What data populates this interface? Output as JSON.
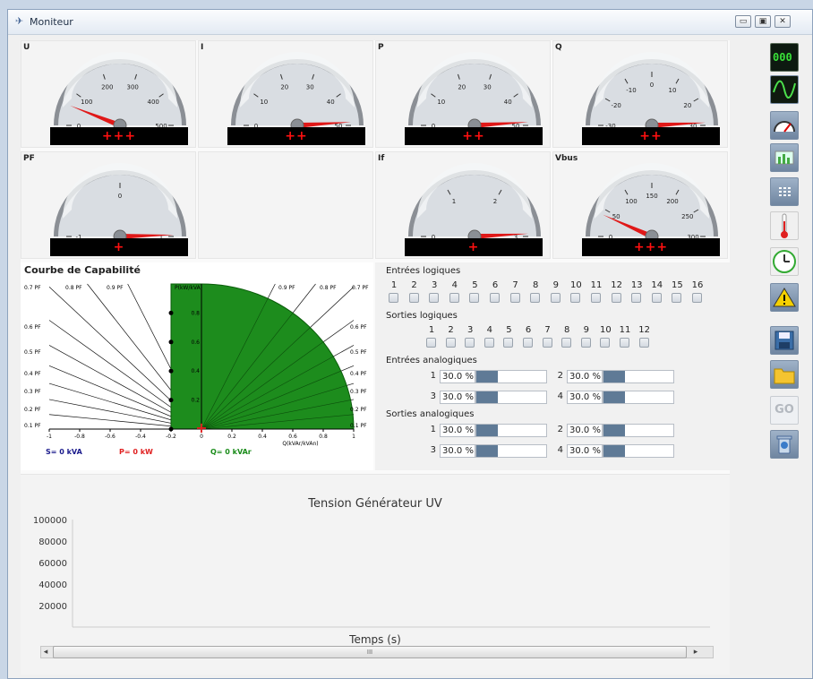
{
  "window": {
    "title": "Moniteur",
    "minimize": "▭",
    "maximize": "▣",
    "close": "✕"
  },
  "gauges": [
    {
      "id": "U",
      "label": "U",
      "ticks": [
        "0",
        "100",
        "200",
        "300",
        "400",
        "500"
      ],
      "indicator": "+++",
      "value": 60,
      "min": 0,
      "max": 500
    },
    {
      "id": "I",
      "label": "I",
      "ticks": [
        "0",
        "10",
        "20",
        "30",
        "40",
        "50"
      ],
      "indicator": "++",
      "value": 49,
      "min": 0,
      "max": 50
    },
    {
      "id": "P",
      "label": "P",
      "ticks": [
        "0",
        "10",
        "20",
        "30",
        "40",
        "50"
      ],
      "indicator": "++",
      "value": 49,
      "min": 0,
      "max": 50
    },
    {
      "id": "Q",
      "label": "Q",
      "ticks": [
        "-30",
        "-20",
        "-10",
        "0",
        "10",
        "20",
        "30"
      ],
      "indicator": "++",
      "value": 29,
      "min": -30,
      "max": 30
    },
    {
      "id": "PF",
      "label": "PF",
      "ticks": [
        "-1",
        "0",
        "1"
      ],
      "indicator": "+",
      "value": 0.98,
      "min": -1,
      "max": 1
    },
    {
      "id": "If",
      "label": "If",
      "ticks": [
        "0",
        "1",
        "2",
        "3"
      ],
      "indicator": "+",
      "value": 2.95,
      "min": 0,
      "max": 3
    },
    {
      "id": "Vbus",
      "label": "Vbus",
      "ticks": [
        "0",
        "50",
        "100",
        "150",
        "200",
        "250",
        "300"
      ],
      "indicator": "+++",
      "value": 40,
      "min": 0,
      "max": 300
    }
  ],
  "capability": {
    "title": "Courbe de Capabilité",
    "pf_left": [
      "0.7 PF",
      "0.8 PF",
      "0.9 PF",
      "0.6 PF",
      "0.5 PF",
      "0.4 PF",
      "0.3 PF",
      "0.2 PF",
      "0.1 PF"
    ],
    "pf_right": [
      "0.9 PF",
      "0.8 PF",
      "0.7 PF",
      "0.6 PF",
      "0.5 PF",
      "0.4 PF",
      "0.3 PF",
      "0.2 PF",
      "0.1 PF"
    ],
    "xticks": [
      "-1",
      "-0.8",
      "-0.6",
      "-0.4",
      "-0.2",
      "0",
      "0.2",
      "0.4",
      "0.6",
      "0.8",
      "1"
    ],
    "yticks": [
      "0.2",
      "0.4",
      "0.6",
      "0.8"
    ],
    "yaxis": "P(kW/kVA)",
    "xaxis": "Q(kVAr/kVAn)",
    "s_label": "S= 0 kVA",
    "p_label": "P= 0 kW",
    "q_label": "Q= 0 kVAr",
    "colors": {
      "fill": "#1d8c1d",
      "s": "#1a1a8c",
      "p": "#e02020",
      "q": "#1a8c1a"
    }
  },
  "io": {
    "entrees_logiques": {
      "title": "Entrées logiques",
      "items": [
        "1",
        "2",
        "3",
        "4",
        "5",
        "6",
        "7",
        "8",
        "9",
        "10",
        "11",
        "12",
        "13",
        "14",
        "15",
        "16"
      ]
    },
    "sorties_logiques": {
      "title": "Sorties logiques",
      "items": [
        "1",
        "2",
        "3",
        "4",
        "5",
        "6",
        "7",
        "8",
        "9",
        "10",
        "11",
        "12"
      ]
    },
    "entrees_analogiques": {
      "title": "Entrées analogiques",
      "items": [
        {
          "index": "1",
          "value": "30.0 %",
          "level": 0.3
        },
        {
          "index": "2",
          "value": "30.0 %",
          "level": 0.3
        },
        {
          "index": "3",
          "value": "30.0 %",
          "level": 0.3
        },
        {
          "index": "4",
          "value": "30.0 %",
          "level": 0.3
        }
      ]
    },
    "sorties_analogiques": {
      "title": "Sorties analogiques",
      "items": [
        {
          "index": "1",
          "value": "30.0 %",
          "level": 0.3
        },
        {
          "index": "2",
          "value": "30.0 %",
          "level": 0.3
        },
        {
          "index": "3",
          "value": "30.0 %",
          "level": 0.3
        },
        {
          "index": "4",
          "value": "30.0 %",
          "level": 0.3
        }
      ]
    }
  },
  "chart_data": {
    "type": "line",
    "title": "Tension Générateur UV",
    "xlabel": "Temps (s)",
    "ylabel": "",
    "yticks": [
      "100000",
      "80000",
      "60000",
      "40000",
      "20000"
    ],
    "ylim": [
      0,
      100000
    ],
    "series": []
  },
  "scrollbar": {
    "left_arrow": "◂",
    "right_arrow": "▸",
    "thumb_grip": "III"
  },
  "sidebar": {
    "digital_display_text": "000",
    "go_label": "GO",
    "icons": [
      "digital-display",
      "oscilloscope",
      "gauge",
      "bar-chart",
      "grid",
      "thermometer",
      "clock",
      "warning",
      "save",
      "folder",
      "go",
      "trash"
    ]
  }
}
